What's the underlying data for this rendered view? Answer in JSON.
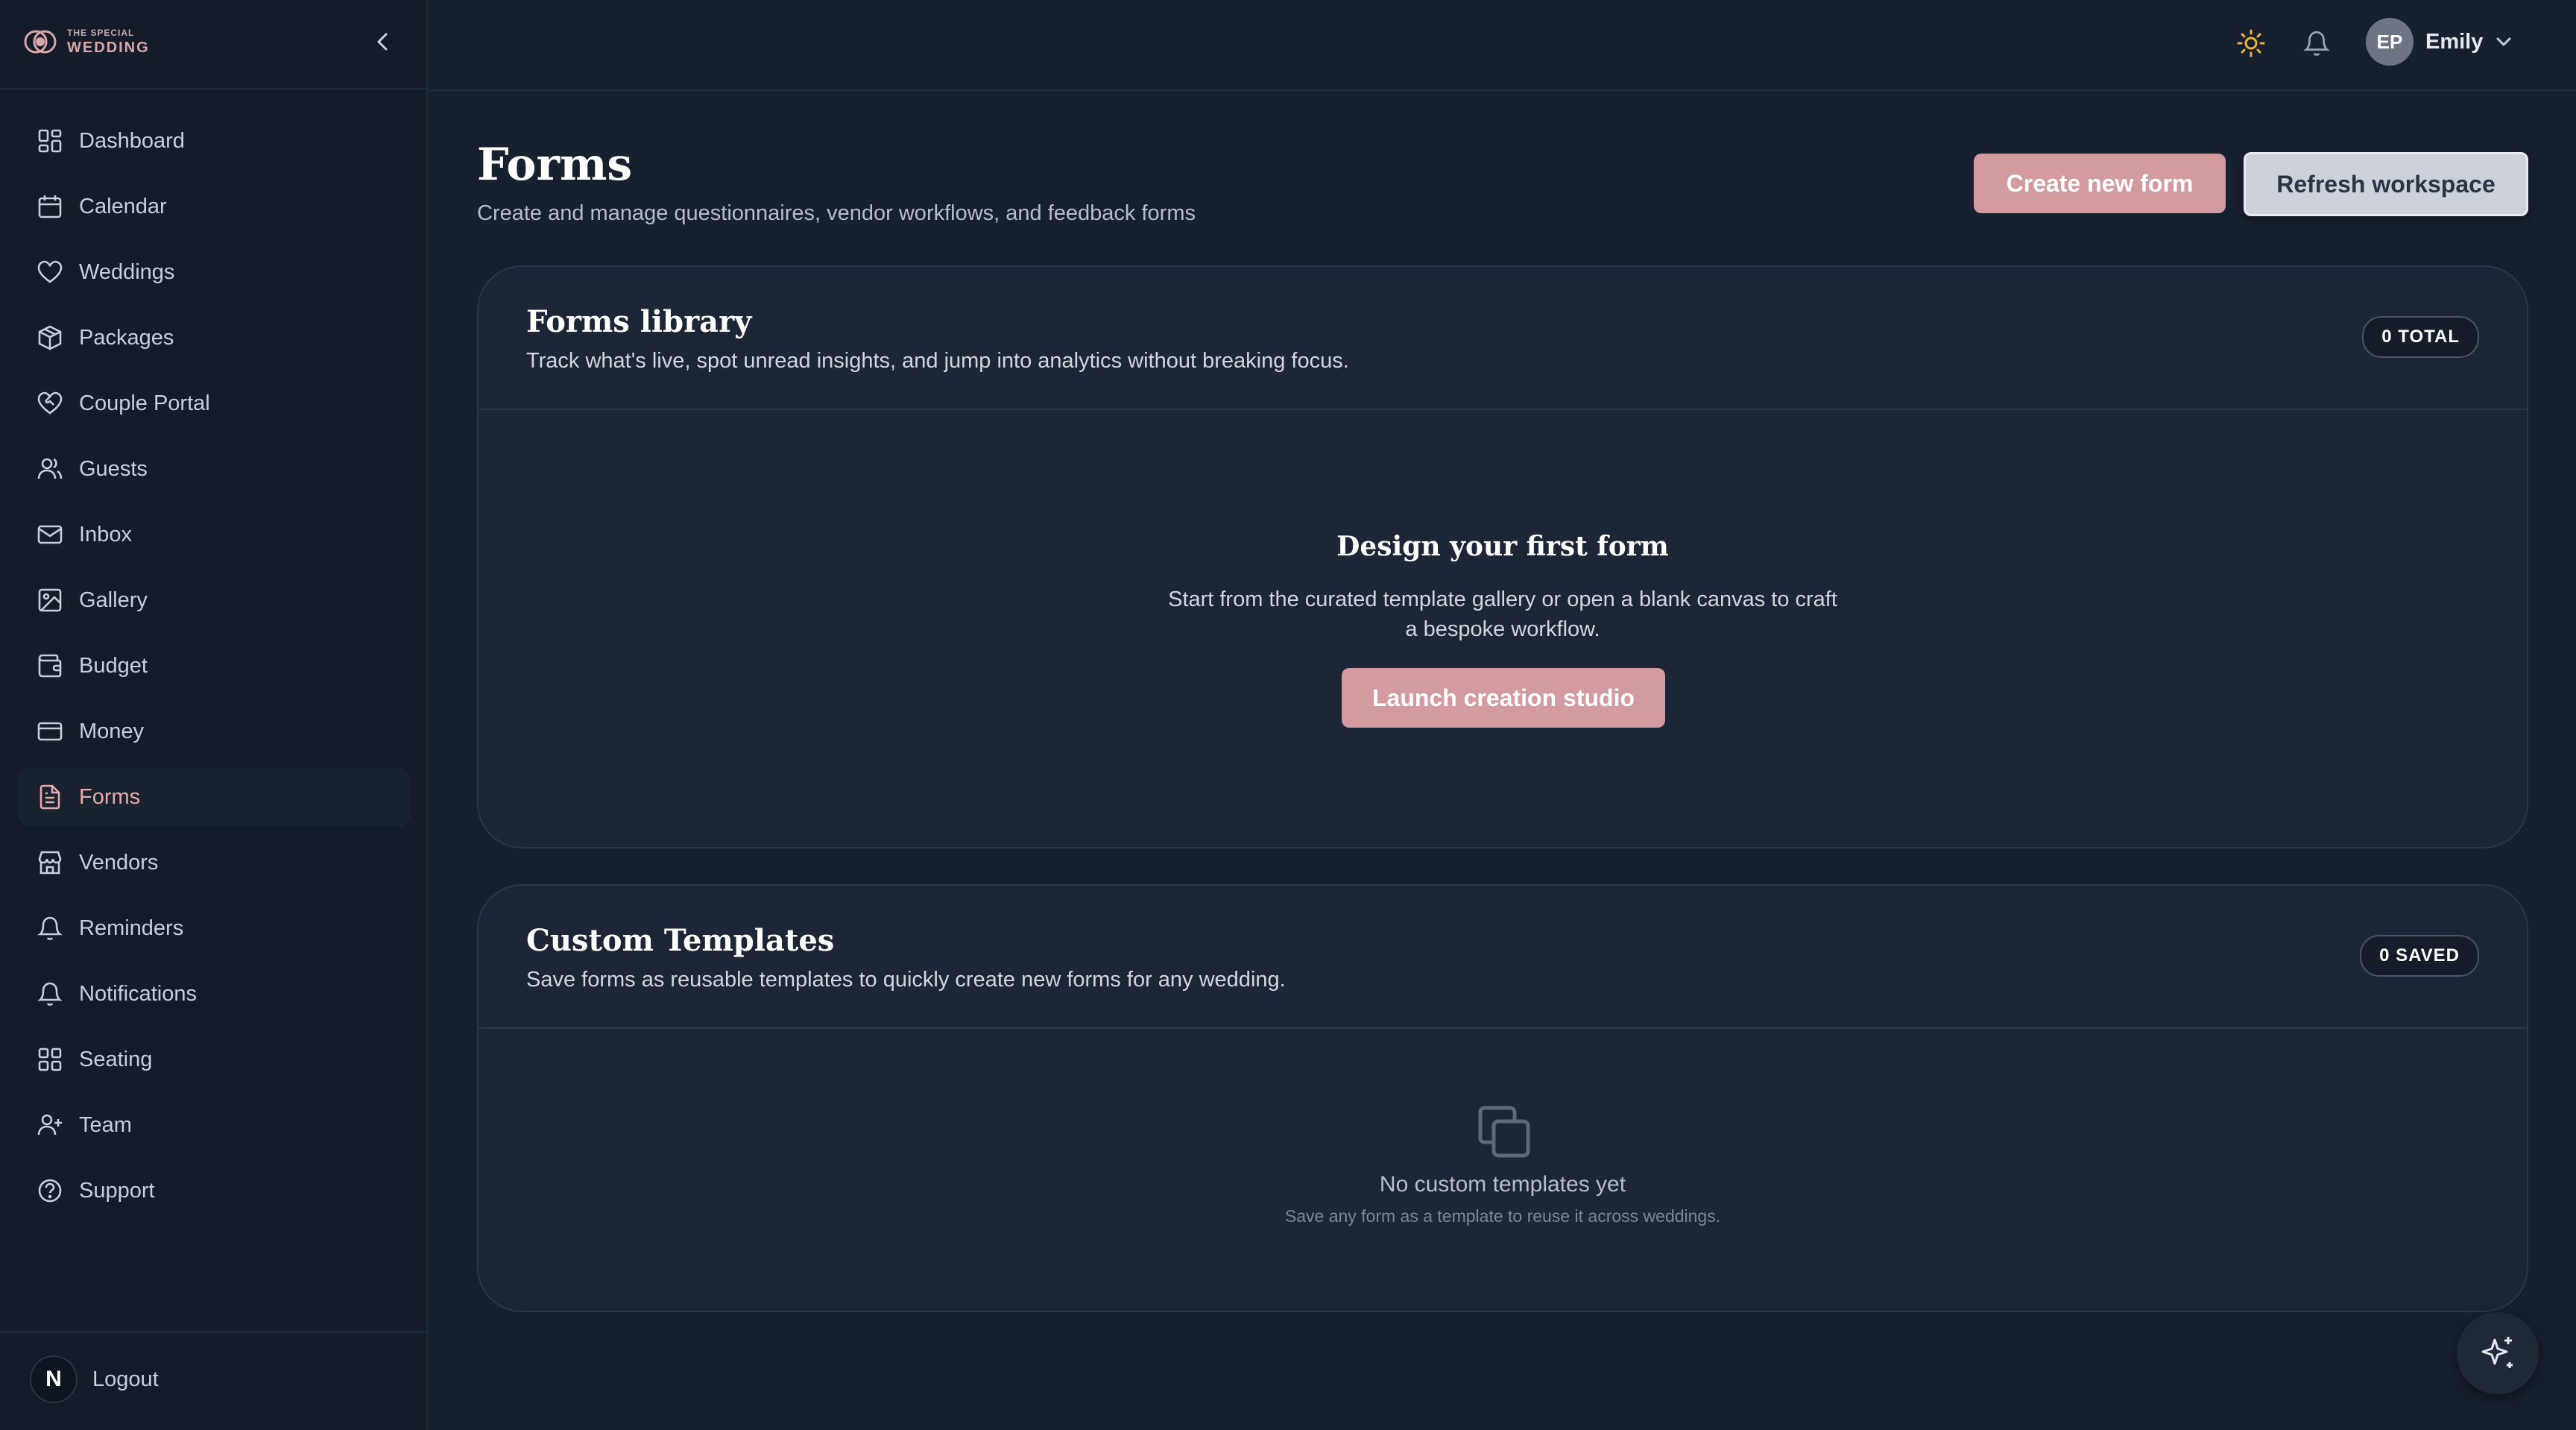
{
  "brand": {
    "small": "THE SPECIAL",
    "big": "WEDDING",
    "accent": "#d9a7a9"
  },
  "sidebar": {
    "items": [
      {
        "label": "Dashboard",
        "icon": "dashboard-icon"
      },
      {
        "label": "Calendar",
        "icon": "calendar-icon"
      },
      {
        "label": "Weddings",
        "icon": "heart-icon"
      },
      {
        "label": "Packages",
        "icon": "package-icon"
      },
      {
        "label": "Couple Portal",
        "icon": "heart-handshake-icon"
      },
      {
        "label": "Guests",
        "icon": "users-icon"
      },
      {
        "label": "Inbox",
        "icon": "mail-icon"
      },
      {
        "label": "Gallery",
        "icon": "image-icon"
      },
      {
        "label": "Budget",
        "icon": "wallet-icon"
      },
      {
        "label": "Money",
        "icon": "credit-card-icon"
      },
      {
        "label": "Forms",
        "icon": "file-text-icon",
        "active": true
      },
      {
        "label": "Vendors",
        "icon": "store-icon"
      },
      {
        "label": "Reminders",
        "icon": "bell-icon"
      },
      {
        "label": "Notifications",
        "icon": "bell-icon"
      },
      {
        "label": "Seating",
        "icon": "grid-icon"
      },
      {
        "label": "Team",
        "icon": "user-plus-icon"
      },
      {
        "label": "Support",
        "icon": "help-circle-icon"
      }
    ],
    "logout_label": "Logout",
    "logout_badge": "N"
  },
  "topbar": {
    "user_initials": "EP",
    "user_name": "Emily"
  },
  "header": {
    "title": "Forms",
    "subtitle": "Create and manage questionnaires, vendor workflows, and feedback forms",
    "create_label": "Create new form",
    "refresh_label": "Refresh workspace"
  },
  "forms_library": {
    "title": "Forms library",
    "subtitle": "Track what's live, spot unread insights, and jump into analytics without breaking focus.",
    "badge": "0 TOTAL",
    "empty_title": "Design your first form",
    "empty_text": "Start from the curated template gallery or open a blank canvas to craft a bespoke workflow.",
    "launch_label": "Launch creation studio"
  },
  "custom_templates": {
    "title": "Custom Templates",
    "subtitle": "Save forms as reusable templates to quickly create new forms for any wedding.",
    "badge": "0 SAVED",
    "empty_title": "No custom templates yet",
    "empty_sub": "Save any form as a template to reuse it across weddings."
  },
  "colors": {
    "accent": "#d39a9f",
    "background": "#17202f",
    "sidebar": "#141c2a",
    "card": "#1d2636",
    "sun": "#f2b13b"
  }
}
